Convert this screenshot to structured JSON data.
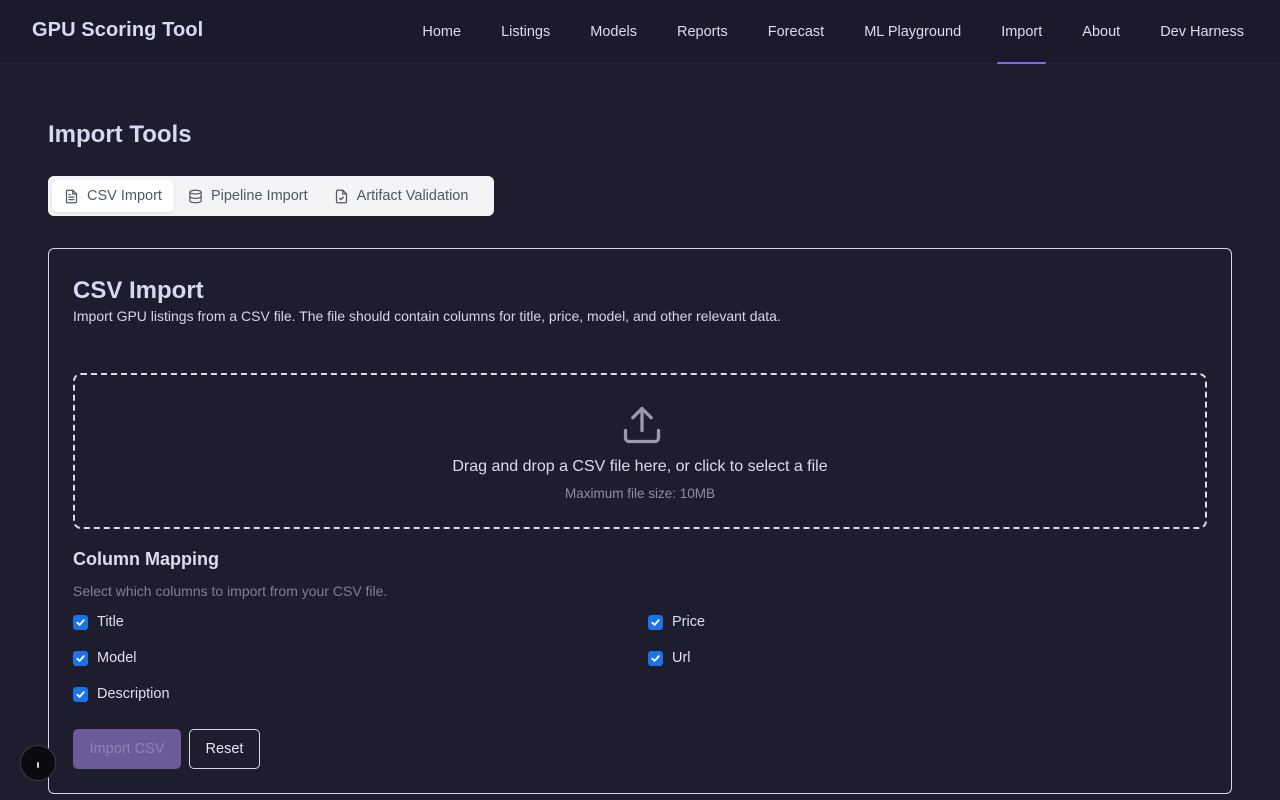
{
  "header": {
    "brand": "GPU Scoring Tool",
    "nav": [
      {
        "label": "Home"
      },
      {
        "label": "Listings"
      },
      {
        "label": "Models"
      },
      {
        "label": "Reports"
      },
      {
        "label": "Forecast"
      },
      {
        "label": "ML Playground"
      },
      {
        "label": "Import",
        "active": true
      },
      {
        "label": "About"
      },
      {
        "label": "Dev Harness"
      }
    ]
  },
  "page": {
    "title": "Import Tools"
  },
  "tabs": [
    {
      "label": "CSV Import",
      "icon": "file-text-icon",
      "active": true
    },
    {
      "label": "Pipeline Import",
      "icon": "database-icon"
    },
    {
      "label": "Artifact Validation",
      "icon": "file-check-icon"
    }
  ],
  "card": {
    "title": "CSV Import",
    "description": "Import GPU listings from a CSV file. The file should contain columns for title, price, model, and other relevant data."
  },
  "dropzone": {
    "icon": "upload-icon",
    "text": "Drag and drop a CSV file here, or click to select a file",
    "subtext": "Maximum file size: 10MB"
  },
  "mapping": {
    "title": "Column Mapping",
    "description": "Select which columns to import from your CSV file.",
    "columns": [
      {
        "label": "Title",
        "checked": true
      },
      {
        "label": "Price",
        "checked": true
      },
      {
        "label": "Model",
        "checked": true
      },
      {
        "label": "Url",
        "checked": true
      },
      {
        "label": "Description",
        "checked": true
      }
    ]
  },
  "actions": {
    "import_label": "Import CSV",
    "reset_label": "Reset"
  },
  "colors": {
    "background": "#1e1d2e",
    "accent": "#7c6cf0",
    "checkbox": "#1a73e8",
    "import_button_disabled": "#6e5a99"
  }
}
